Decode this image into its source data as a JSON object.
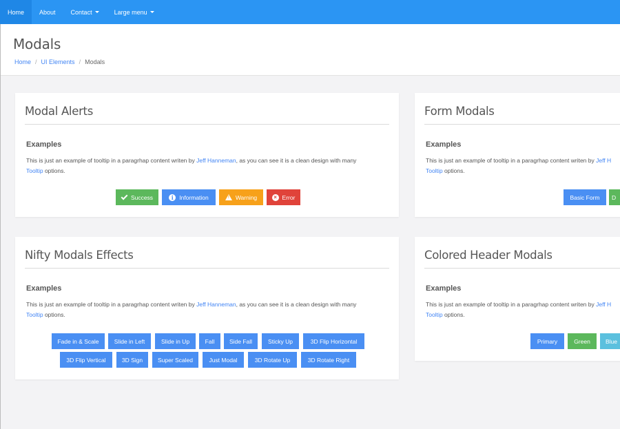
{
  "navbar": {
    "items": [
      {
        "label": "Home"
      },
      {
        "label": "About"
      },
      {
        "label": "Contact"
      },
      {
        "label": "Large menu"
      }
    ]
  },
  "page": {
    "title": "Modals",
    "breadcrumb": [
      "Home",
      "UI Elements",
      "Modals"
    ]
  },
  "panels": {
    "alerts": {
      "title": "Modal Alerts",
      "subtitle": "Examples",
      "text_pre": "This is just an example of tooltip in a paragrhap content writen by ",
      "link1": "Jeff Hanneman",
      "text_mid": ", as you can see it is a clean design with many ",
      "link2": "Tooltip",
      "text_post": " options.",
      "buttons": [
        "Success",
        "Information",
        "Warning",
        "Error"
      ]
    },
    "form": {
      "title": "Form Modals",
      "subtitle": "Examples",
      "text_pre": "This is just an example of tooltip in a paragrhap content writen by ",
      "link1": "Jeff H",
      "link2": "Tooltip",
      "text_post": " options.",
      "buttons": [
        "Basic Form",
        "D"
      ]
    },
    "nifty": {
      "title": "Nifty Modals Effects",
      "subtitle": "Examples",
      "text_pre": "This is just an example of tooltip in a paragrhap content writen by ",
      "link1": "Jeff Hanneman",
      "text_mid": ", as you can see it is a clean design with many ",
      "link2": "Tooltip",
      "text_post": " options.",
      "buttons_row1": [
        "Fade in & Scale",
        "Slide in Left",
        "Slide in Up",
        "Fall",
        "Side Fall",
        "Sticky Up",
        "3D Flip Horizontal"
      ],
      "buttons_row2": [
        "3D Flip Vertical",
        "3D Sign",
        "Super Scaled",
        "Just Modal",
        "3D Rotate Up",
        "3D Rotate Right"
      ]
    },
    "colored": {
      "title": "Colored Header Modals",
      "subtitle": "Examples",
      "text_pre": "This is just an example of tooltip in a paragrhap content writen by ",
      "link1": "Jeff H",
      "link2": "Tooltip",
      "text_post": " options.",
      "buttons": [
        "Primary",
        "Green",
        "Blue"
      ]
    }
  },
  "colors": {
    "navbar": "#2b95f3",
    "primary": "#4a8ff3",
    "success": "#5cb85c",
    "warning": "#f7a11a",
    "danger": "#e0433a",
    "info": "#5bc0de"
  }
}
